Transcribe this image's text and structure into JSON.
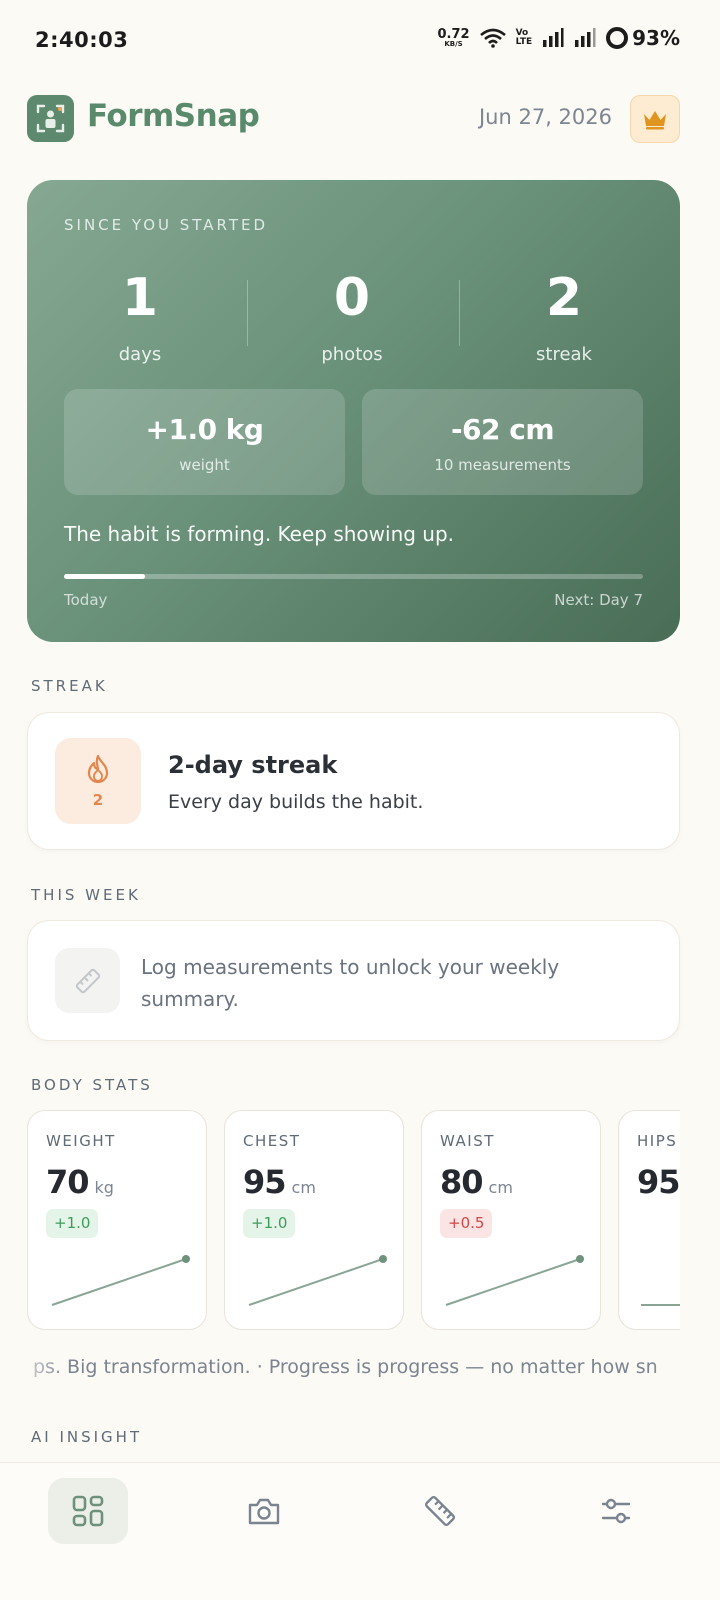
{
  "status_bar": {
    "time": "2:40:03",
    "net_speed_value": "0.72",
    "net_speed_unit": "KB/S",
    "volte_top": "Vo",
    "volte_bottom": "LTE",
    "battery": "93%"
  },
  "header": {
    "app_name": "FormSnap",
    "date": "Jun 27, 2026",
    "crown_icon": "crown-icon"
  },
  "hero": {
    "eyebrow": "SINCE YOU STARTED",
    "stats": [
      {
        "value": "1",
        "label": "days"
      },
      {
        "value": "0",
        "label": "photos"
      },
      {
        "value": "2",
        "label": "streak"
      }
    ],
    "tiles": [
      {
        "value": "+1.0 kg",
        "label": "weight"
      },
      {
        "value": "-62 cm",
        "label": "10 measurements"
      }
    ],
    "message": "The habit is forming. Keep showing up.",
    "progress": 0.14,
    "progress_left": "Today",
    "progress_right": "Next: Day 7"
  },
  "streak_section": {
    "title": "STREAK",
    "badge_count": "2",
    "headline": "2-day streak",
    "subtitle": "Every day builds the habit."
  },
  "week_section": {
    "title": "THIS WEEK",
    "message": "Log measurements to unlock your weekly summary."
  },
  "body_stats": {
    "title": "BODY STATS",
    "cards": [
      {
        "name": "WEIGHT",
        "value": "70",
        "unit": "kg",
        "delta": "+1.0",
        "trend": "up"
      },
      {
        "name": "CHEST",
        "value": "95",
        "unit": "cm",
        "delta": "+1.0",
        "trend": "up"
      },
      {
        "name": "WAIST",
        "value": "80",
        "unit": "cm",
        "delta": "+0.5",
        "trend": "up"
      },
      {
        "name": "HIPS",
        "value": "95",
        "unit": "",
        "delta": "",
        "trend": "flat"
      }
    ]
  },
  "ticker": {
    "text": "ps. Big transformation.   ·   Progress is progress — no matter how sn"
  },
  "ai_section": {
    "title": "AI INSIGHT"
  },
  "nav": {
    "items": [
      "dashboard-icon",
      "camera-icon",
      "ruler-icon",
      "settings-sliders-icon"
    ],
    "active": 0
  },
  "colors": {
    "brand": "#5a8a6c",
    "hero_start": "#86a893",
    "hero_end": "#496d56",
    "streak_accent": "#e2874d",
    "positive": "#3f9b5c",
    "negative": "#d04848",
    "crown": "#e0951f"
  }
}
